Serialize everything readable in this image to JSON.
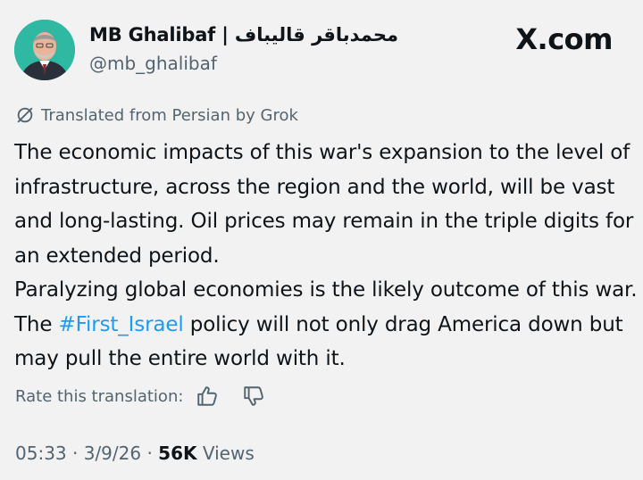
{
  "post": {
    "author_name": "MB Ghalibaf | محمدباقر قالیباف",
    "author_handle": "@mb_ghalibaf",
    "brand": "X.com",
    "translated_label": "Translated from Persian by Grok",
    "paragraph1": "The economic impacts of this war's expansion to the level of infrastructure, across the region and the world, will be vast and long-lasting. Oil prices may remain in the triple digits for an extended period.",
    "paragraph2_before": "Paralyzing global economies is the likely outcome of this war. The ",
    "hashtag": "#First_Israel",
    "paragraph2_after": " policy will not only drag America down but may pull the entire world with it.",
    "rate_label": "Rate this translation:",
    "time": "05:33",
    "date": "3/9/26",
    "views_count": "56K",
    "views_label": "Views"
  },
  "icons": {
    "avatar": "profile-photo",
    "translate": "grok-translate-icon",
    "thumbs_up": "thumbs-up-icon",
    "thumbs_down": "thumbs-down-icon"
  },
  "colors": {
    "background": "#f2f2f2",
    "text": "#0f1419",
    "secondary_text": "#536471",
    "hashtag": "#1d9bf0",
    "avatar_bg": "#2fb9a2"
  }
}
